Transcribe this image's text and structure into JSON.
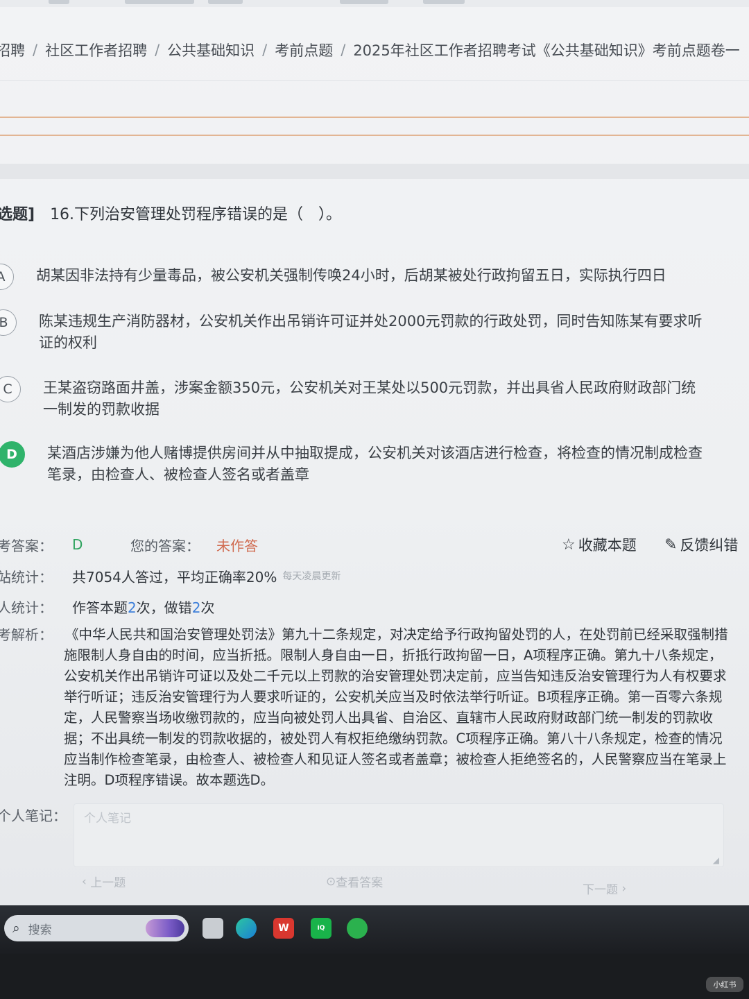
{
  "breadcrumb": {
    "items": [
      "招聘",
      "社区工作者招聘",
      "公共基础知识",
      "考前点题",
      "2025年社区工作者招聘考试《公共基础知识》考前点题卷一"
    ],
    "separator": "/"
  },
  "question": {
    "type_tag": "选题]",
    "text": "16.下列治安管理处罚程序错误的是（　）。"
  },
  "options": [
    {
      "letter": "A",
      "text": "胡某因非法持有少量毒品，被公安机关强制传唤24小时，后胡某被处行政拘留五日，实际执行四日",
      "selected_correct": false
    },
    {
      "letter": "B",
      "text": "陈某违规生产消防器材，公安机关作出吊销许可证并处2000元罚款的行政处罚，同时告知陈某有要求听证的权利",
      "selected_correct": false
    },
    {
      "letter": "C",
      "text": "王某盗窃路面井盖，涉案金额350元，公安机关对王某处以500元罚款，并出具省人民政府财政部门统一制发的罚款收据",
      "selected_correct": false
    },
    {
      "letter": "D",
      "text": "某酒店涉嫌为他人赌博提供房间并从中抽取提成，公安机关对该酒店进行检查，将检查的情况制成检查笔录，由检查人、被检查人签名或者盖章",
      "selected_correct": true
    }
  ],
  "answer": {
    "ref_label": "考答案：",
    "ref_value": "D",
    "yours_label": "您的答案：",
    "yours_value": "未作答"
  },
  "actions": {
    "favorite_label": "收藏本题",
    "feedback_label": "反馈纠错"
  },
  "stats": {
    "site_label": "站统计：",
    "site_text": "共7054人答过，平均正确率20%",
    "site_note": "每天凌晨更新",
    "personal_label": "人统计：",
    "personal_prefix": "作答本题",
    "personal_count1": "2",
    "personal_mid": "次，做错",
    "personal_count2": "2",
    "personal_suffix": "次"
  },
  "analysis": {
    "label": "考解析：",
    "text": "《中华人民共和国治安管理处罚法》第九十二条规定，对决定给予行政拘留处罚的人，在处罚前已经采取强制措施限制人身自由的时间，应当折抵。限制人身自由一日，折抵行政拘留一日，A项程序正确。第九十八条规定，公安机关作出吊销许可证以及处二千元以上罚款的治安管理处罚决定前，应当告知违反治安管理行为人有权要求举行听证；违反治安管理行为人要求听证的，公安机关应当及时依法举行听证。B项程序正确。第一百零六条规定，人民警察当场收缴罚款的，应当向被处罚人出具省、自治区、直辖市人民政府财政部门统一制发的罚款收据；不出具统一制发的罚款收据的，被处罚人有权拒绝缴纳罚款。C项程序正确。第八十八条规定，检查的情况应当制作检查笔录，由检查人、被检查人和见证人签名或者盖章；被检查人拒绝签名的，人民警察应当在笔录上注明。D项程序错误。故本题选D。"
  },
  "notes": {
    "label": "个人笔记：",
    "placeholder": "个人笔记"
  },
  "nav": {
    "prev_label": "上一题",
    "view_answer_label": "查看答案",
    "next_label": "下一题"
  },
  "taskbar": {
    "search_placeholder": "搜索",
    "icons": [
      "file-explorer-icon",
      "edge-browser-icon",
      "wps-icon",
      "iqiyi-icon",
      "wechat-icon"
    ]
  },
  "watermark": "小红书",
  "colors": {
    "correct_green": "#2fb36b",
    "answer_green": "#2fa35f",
    "unanswered_red": "#d06a4f",
    "count_blue": "#3d7fd9",
    "divider_orange": "#e2b593"
  }
}
